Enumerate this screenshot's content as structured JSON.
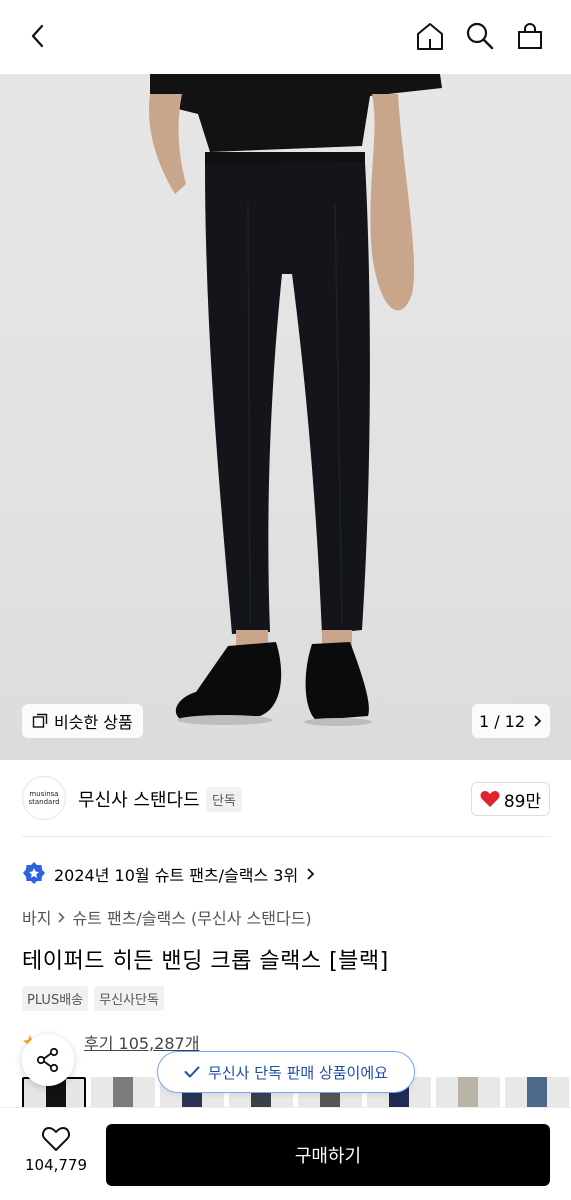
{
  "header": {
    "back_icon": "chevron-left-icon",
    "home_icon": "home-icon",
    "search_icon": "search-icon",
    "cart_icon": "shopping-bag-icon"
  },
  "gallery": {
    "similar_label": "비슷한 상품",
    "page_indicator": "1 / 12"
  },
  "brand": {
    "logo_line1": "musinsa",
    "logo_line2": "standard",
    "name": "무신사 스탠다드",
    "badge": "단독",
    "likes": "89만"
  },
  "rank": {
    "text": "2024년 10월 슈트 팬츠/슬랙스 3위"
  },
  "breadcrumb": {
    "level1": "바지",
    "level2": "슈트 팬츠/슬랙스 (무신사 스탠다드)"
  },
  "product": {
    "title": "테이퍼드 히든 밴딩 크롭 슬랙스 [블랙]",
    "tags": [
      "PLUS배송",
      "무신사단독"
    ],
    "review_label": "후기 105,287개"
  },
  "toast": {
    "text": "무신사 단독 판매 상품이에요"
  },
  "bottom": {
    "wish_count": "104,779",
    "buy_label": "구매하기"
  },
  "colors": {
    "accent_heart": "#e0242c",
    "toast_border": "#7aa8f0",
    "rank_badge": "#2a64e0"
  }
}
